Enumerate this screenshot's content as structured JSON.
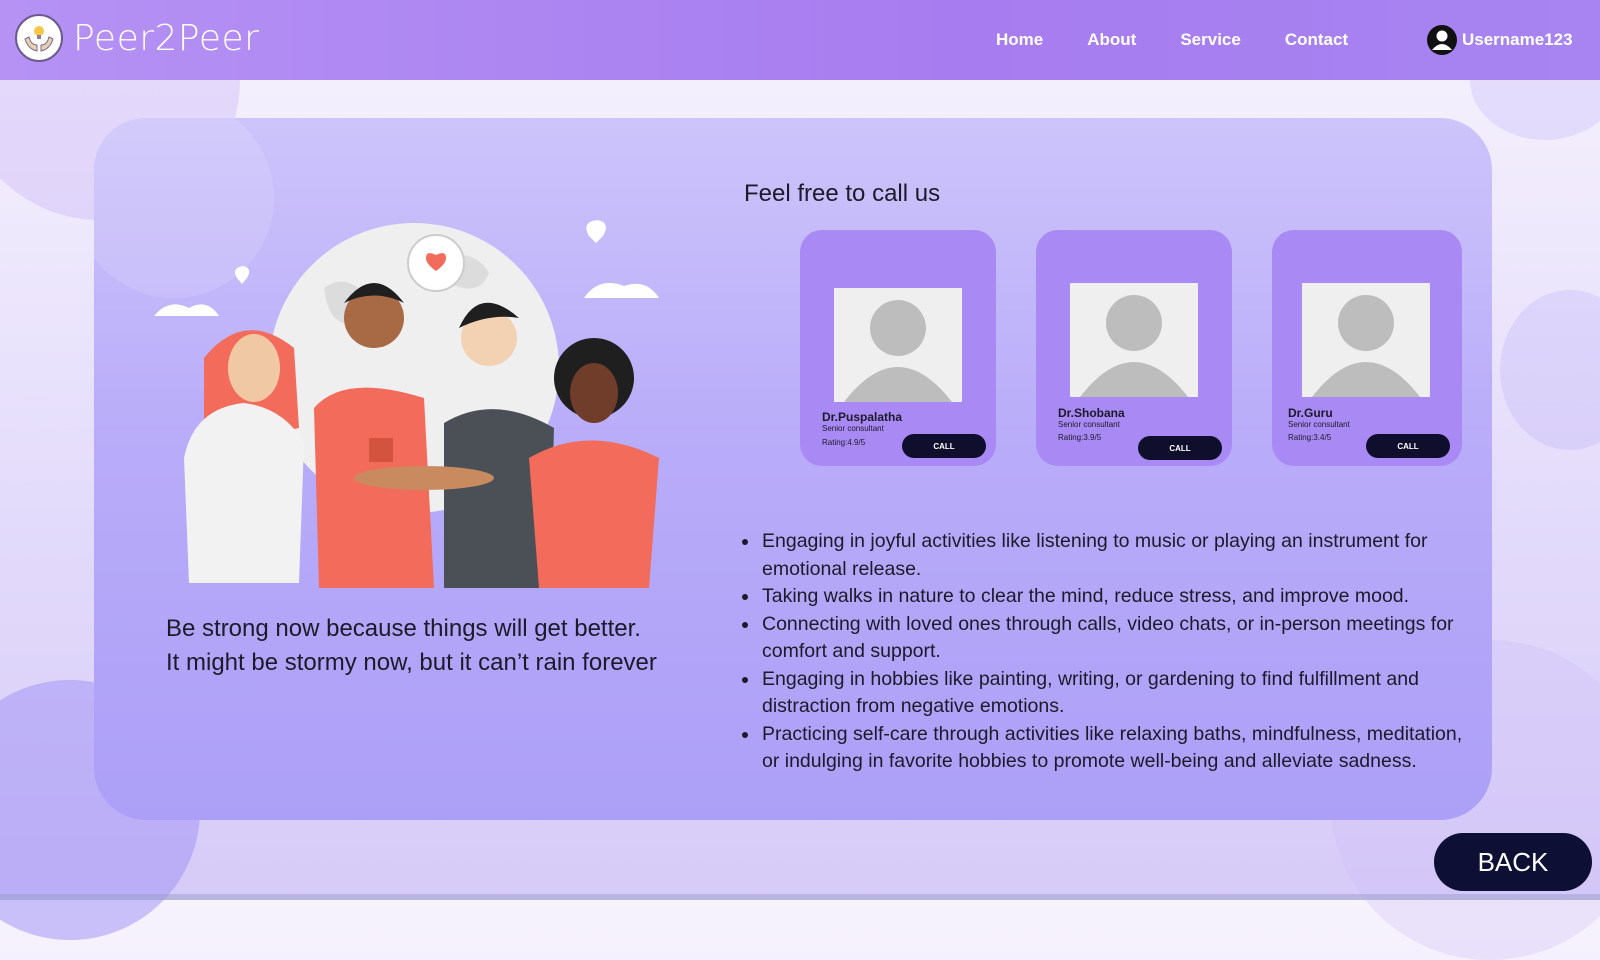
{
  "brand": {
    "name": "Peer2Peer",
    "logo_icon": "hands-lightbulb-icon"
  },
  "nav": {
    "links": [
      "Home",
      "About",
      "Service",
      "Contact"
    ],
    "username": "Username123",
    "user_icon": "user-circle-icon"
  },
  "quote": {
    "line1": "Be strong now because things will get better.",
    "line2": "It might be stormy now, but it can’t rain forever"
  },
  "call_section": {
    "title": "Feel free to call us",
    "doctors": [
      {
        "name": "Dr.Puspalatha",
        "role": "Senior consultant",
        "rating": "Rating:4.9/5",
        "button": "CALL"
      },
      {
        "name": "Dr.Shobana",
        "role": "Senior consultant",
        "rating": "Rating:3.9/5",
        "button": "CALL"
      },
      {
        "name": "Dr.Guru",
        "role": "Senior consultant",
        "rating": "Rating:3.4/5",
        "button": "CALL"
      }
    ]
  },
  "tips": [
    "Engaging in joyful activities like listening to music or playing an instrument for emotional release.",
    "Taking walks in nature to clear the mind, reduce stress, and improve mood.",
    "Connecting with loved ones through calls, video chats, or in-person meetings for comfort and support.",
    "Engaging in hobbies like painting, writing, or gardening to find fulfillment and distraction from negative emotions.",
    "Practicing self-care through activities like relaxing baths, mindfulness, meditation, or indulging in favorite hobbies to promote well-being and alleviate sadness."
  ],
  "back_button": "BACK",
  "colors": {
    "navbar": "#a77cf0",
    "panel": "#b9acf9",
    "card": "#a98af4",
    "button_dark": "#0f0f2d"
  }
}
